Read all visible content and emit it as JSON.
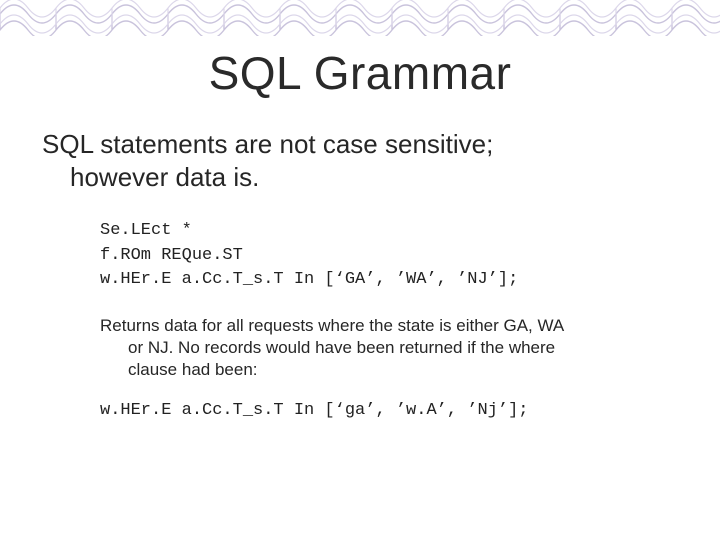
{
  "title": "SQL Grammar",
  "lead": {
    "line1": "SQL statements are not case sensitive;",
    "line2": "however data is."
  },
  "code": {
    "l1": "Se.LEct *",
    "l2": "f.ROm REQue.ST",
    "l3": "w.HEr.E a.Cc.T_s.T In [‘GA’, ’WA’, ’NJ’];"
  },
  "explain": {
    "l1": "Returns data for all requests where the state is either GA, WA",
    "l2": "or NJ.  No records would have been returned if the where",
    "l3": "clause had been:"
  },
  "code2": {
    "l1": "w.HEr.E a.Cc.T_s.T In [‘ga’, ’w.A’, ’Nj’];"
  }
}
